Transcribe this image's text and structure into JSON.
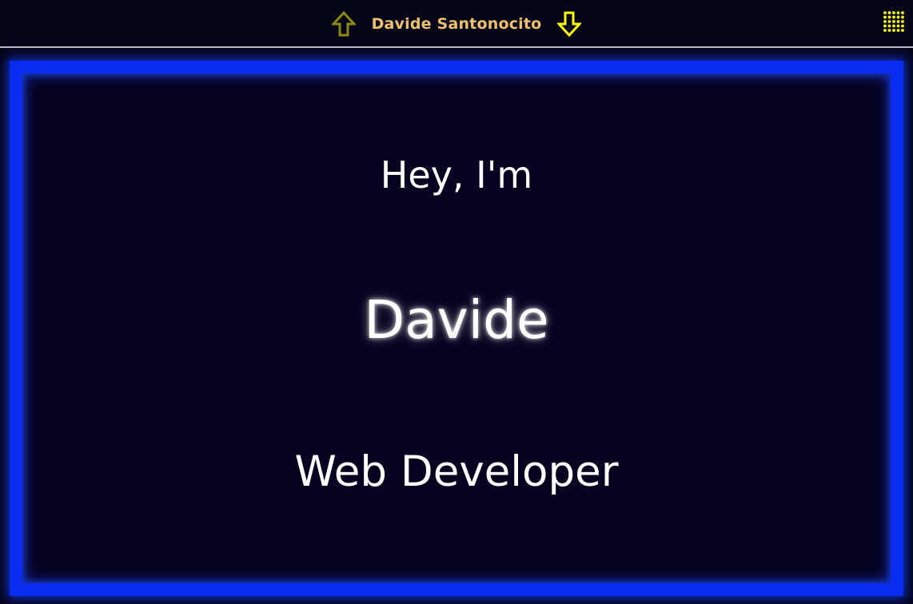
{
  "header": {
    "title": "Davide Santonocito",
    "prev_icon": "arrow-up-icon",
    "next_icon": "arrow-down-icon",
    "menu_icon": "grid-menu-icon",
    "colors": {
      "title": "#f0c070",
      "prev_arrow": "#8a8a10",
      "next_arrow": "#ffff00",
      "menu_icon": "#ffff00"
    }
  },
  "hero": {
    "greeting": "Hey, I'm",
    "name": "Davide",
    "role": "Web Developer",
    "colors": {
      "frame": "#0a2cf0",
      "background": "#05031f",
      "text": "#ffffff"
    }
  }
}
